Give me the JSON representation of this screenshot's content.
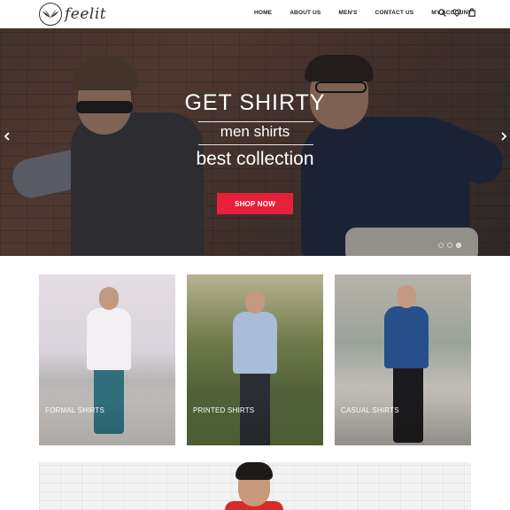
{
  "brand": {
    "name": "feelit"
  },
  "nav": {
    "items": [
      {
        "label": "HOME"
      },
      {
        "label": "ABOUT US"
      },
      {
        "label": "MEN'S"
      },
      {
        "label": "CONTACT US"
      },
      {
        "label": "MY ACCOUNT"
      }
    ]
  },
  "header_icons": [
    "search-icon",
    "heart-icon",
    "cart-icon"
  ],
  "hero": {
    "title": "GET SHIRTY",
    "subtitle": "men shirts",
    "tagline": "best collection",
    "cta_label": "SHOP NOW",
    "cta_color": "#e8213a",
    "slide_count": 3,
    "active_slide": 3
  },
  "categories": [
    {
      "label": "FORMAL SHIRTS"
    },
    {
      "label": "PRINTED SHIRTS"
    },
    {
      "label": "CASUAL SHIRTS"
    }
  ]
}
